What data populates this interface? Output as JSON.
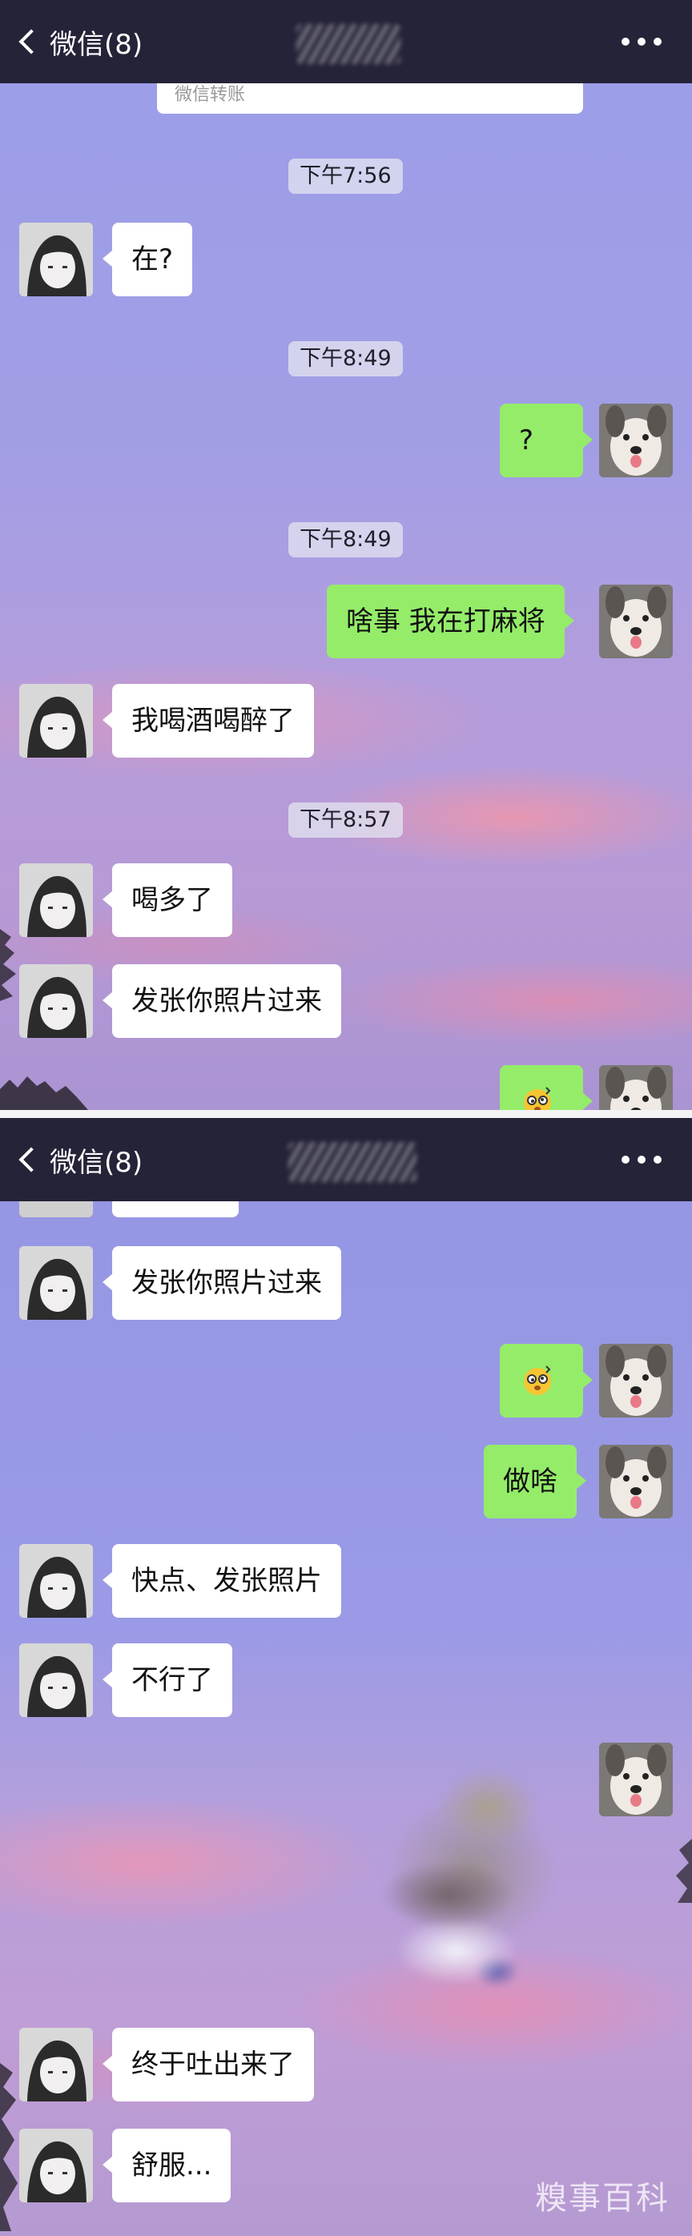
{
  "header": {
    "back_label": "微信(8)",
    "back_icon": "chevron-left-icon",
    "more_icon": "more-dots-icon"
  },
  "panel1": {
    "cutoff_card_text": "微信转账",
    "times": [
      "下午7:56",
      "下午8:49",
      "下午8:49",
      "下午8:57"
    ],
    "messages": [
      {
        "side": "in",
        "text": "在?"
      },
      {
        "side": "out",
        "text": "?"
      },
      {
        "side": "out",
        "text": "啥事 我在打麻将"
      },
      {
        "side": "in",
        "text": "我喝酒喝醉了"
      },
      {
        "side": "in",
        "text": "喝多了"
      },
      {
        "side": "in",
        "text": "发张你照片过来"
      },
      {
        "side": "out",
        "emoji": "dizzy-face-emoji"
      }
    ]
  },
  "panel2": {
    "messages": [
      {
        "side": "in",
        "text": "发张你照片过来"
      },
      {
        "side": "out",
        "emoji": "dizzy-face-emoji"
      },
      {
        "side": "out",
        "text": "做啥"
      },
      {
        "side": "in",
        "text": "快点、发张照片"
      },
      {
        "side": "in",
        "text": "不行了"
      },
      {
        "side": "out",
        "image": "blurred-photo"
      },
      {
        "side": "in",
        "text": "终于吐出来了"
      },
      {
        "side": "in",
        "text": "舒服..."
      }
    ],
    "watermark": "糗事百科"
  },
  "colors": {
    "outgoing_bubble": "#95ec69",
    "incoming_bubble": "#ffffff",
    "topbar": "#1e1c2d"
  }
}
